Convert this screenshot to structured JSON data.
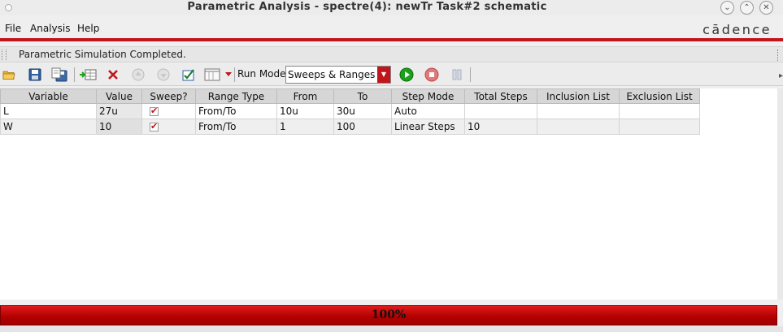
{
  "window": {
    "title": "Parametric Analysis - spectre(4): newTr Task#2 schematic",
    "controls": [
      "minimize-icon",
      "maximize-icon",
      "close-icon"
    ]
  },
  "menu": {
    "file": "File",
    "analysis": "Analysis",
    "help": "Help",
    "brand": "cādence"
  },
  "status": {
    "text": "Parametric Simulation Completed."
  },
  "toolbar": {
    "icons": [
      "open-folder-icon",
      "save-icon",
      "save-as-icon",
      "add-variable-icon",
      "delete-icon",
      "move-up-icon",
      "move-down-icon",
      "check-icon",
      "table-view-icon"
    ],
    "run_mode_label": "Run Mode:",
    "run_mode_value": "Sweeps & Ranges",
    "run_icon": "run-icon",
    "stop_icon": "stop-icon",
    "pause_icon": "pause-icon"
  },
  "table": {
    "headers": [
      "Variable",
      "Value",
      "Sweep?",
      "Range Type",
      "From",
      "To",
      "Step Mode",
      "Total Steps",
      "Inclusion List",
      "Exclusion List"
    ],
    "rows": [
      {
        "variable": "L",
        "value": "27u",
        "sweep": true,
        "range_type": "From/To",
        "from": "10u",
        "to": "30u",
        "step_mode": "Auto",
        "total_steps": "",
        "inclusion": "",
        "exclusion": ""
      },
      {
        "variable": "W",
        "value": "10",
        "sweep": true,
        "range_type": "From/To",
        "from": "1",
        "to": "100",
        "step_mode": "Linear Steps",
        "total_steps": "10",
        "inclusion": "",
        "exclusion": ""
      }
    ]
  },
  "progress": {
    "percent": 100,
    "label": "100%"
  },
  "colors": {
    "accent_red": "#c0151b",
    "run_green": "#1aa31a",
    "stop_red": "#d94040"
  }
}
